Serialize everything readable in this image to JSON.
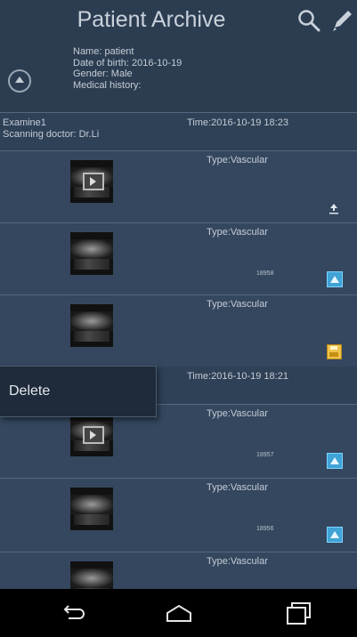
{
  "header": {
    "title": "Patient Archive",
    "search_icon": "search-icon",
    "edit_icon": "edit-icon"
  },
  "patient": {
    "name": "Name: patient",
    "dob": "Date of birth: 2016-10-19",
    "gender": "Gender: Male",
    "history": "Medical history:"
  },
  "exam1": {
    "name": "Examine1",
    "doctor": "Scanning doctor: Dr.Li",
    "time": "Time:2016-10-19 18:23"
  },
  "exam2": {
    "time": "Time:2016-10-19 18:21"
  },
  "cards": [
    {
      "type": "Type:Vascular",
      "number": "",
      "icon": "upload-icon"
    },
    {
      "type": "Type:Vascular",
      "number": "18958",
      "icon": "cloud-icon"
    },
    {
      "type": "Type:Vascular",
      "number": "",
      "icon": "save-icon"
    },
    {
      "type": "Type:Vascular",
      "number": "18957",
      "icon": "cloud-icon"
    },
    {
      "type": "Type:Vascular",
      "number": "18956",
      "icon": "cloud-icon"
    },
    {
      "type": "Type:Vascular",
      "number": "",
      "icon": ""
    }
  ],
  "context_menu": {
    "delete_label": "Delete"
  },
  "navbar": {
    "back": "back-icon",
    "home": "home-icon",
    "recents": "recents-icon"
  },
  "colors": {
    "background": "#34475f",
    "header": "#2c3d52",
    "accent": "#3fa3d6"
  }
}
